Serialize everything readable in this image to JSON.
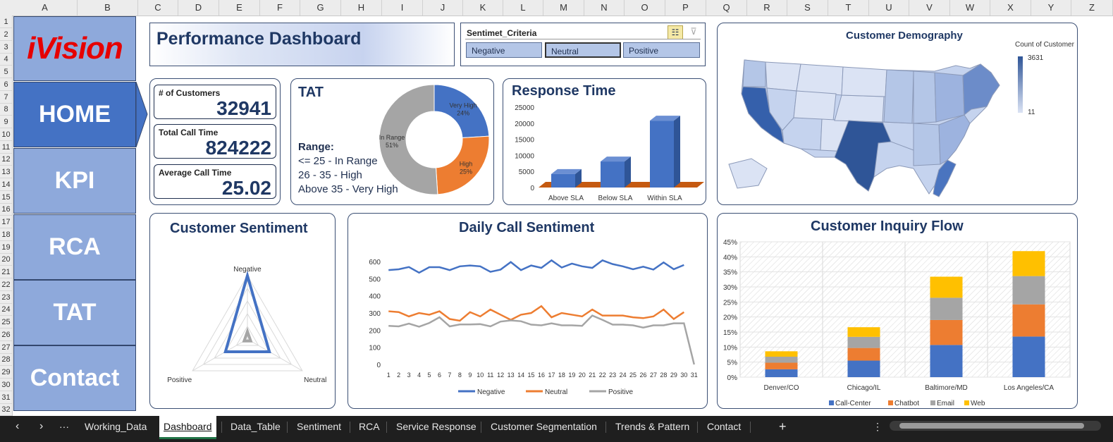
{
  "columns": [
    "A",
    "B",
    "C",
    "D",
    "E",
    "F",
    "G",
    "H",
    "I",
    "J",
    "K",
    "L",
    "M",
    "N",
    "O",
    "P",
    "Q",
    "R",
    "S",
    "T",
    "U",
    "V",
    "W",
    "X",
    "Y",
    "Z"
  ],
  "rows": [
    "1",
    "2",
    "3",
    "4",
    "5",
    "6",
    "7",
    "8",
    "9",
    "10",
    "11",
    "12",
    "13",
    "14",
    "15",
    "16",
    "17",
    "18",
    "19",
    "20",
    "21",
    "22",
    "23",
    "24",
    "25",
    "26",
    "27",
    "28",
    "29",
    "30",
    "31",
    "32"
  ],
  "logo_text": "iVision",
  "nav": {
    "home": "HOME",
    "kpi": "KPI",
    "rca": "RCA",
    "tat": "TAT",
    "contact": "Contact"
  },
  "title": "Performance Dashboard",
  "slicer": {
    "header": "Sentimet_Criteria",
    "options": [
      "Negative",
      "Neutral",
      "Positive"
    ],
    "selected": "Neutral"
  },
  "kpis": {
    "customers": {
      "label": "# of Customers",
      "value": "32941"
    },
    "call_time": {
      "label": "Total Call Time",
      "value": "824222"
    },
    "avg_time": {
      "label": "Average Call Time",
      "value": "25.02"
    }
  },
  "tat": {
    "title": "TAT",
    "range_title": "Range:",
    "range_lines": [
      "<= 25 - In Range",
      "26 - 35 - High",
      "Above 35 - Very High"
    ]
  },
  "response": {
    "title": "Response Time"
  },
  "demography": {
    "title": "Customer Demography",
    "legend_title": "Count of Customer",
    "legend_max": "3631",
    "legend_min": "11"
  },
  "sentiment": {
    "title": "Customer Sentiment"
  },
  "daily": {
    "title": "Daily Call Sentiment"
  },
  "inquiry": {
    "title": "Customer Inquiry Flow"
  },
  "chart_data": [
    {
      "type": "pie",
      "variant": "donut",
      "labels": [
        "Very High",
        "High",
        "In Range"
      ],
      "values": [
        24,
        25,
        51
      ],
      "colors": [
        "#4472c4",
        "#ed7d31",
        "#a5a5a5"
      ]
    },
    {
      "type": "bar",
      "variant": "3d-column",
      "title": "Response Time",
      "categories": [
        "Above SLA",
        "Below SLA",
        "Within SLA"
      ],
      "values": [
        4200,
        8100,
        20800
      ],
      "ylim": [
        0,
        25000
      ],
      "yticks": [
        0,
        5000,
        10000,
        15000,
        20000,
        25000
      ],
      "color": "#4472c4"
    },
    {
      "type": "radar",
      "title": "Customer Sentiment",
      "axes": [
        "Negative",
        "Neutral",
        "Positive"
      ],
      "series": [
        {
          "values": [
            100,
            40,
            40
          ],
          "color": "#4472c4"
        },
        {
          "values": [
            12,
            6,
            6
          ],
          "color": "#a5a5a5"
        }
      ]
    },
    {
      "type": "line",
      "title": "Daily Call Sentiment",
      "x": [
        1,
        2,
        3,
        4,
        5,
        6,
        7,
        8,
        9,
        10,
        11,
        12,
        13,
        14,
        15,
        16,
        17,
        18,
        19,
        20,
        21,
        22,
        23,
        24,
        25,
        26,
        27,
        28,
        29,
        30,
        31
      ],
      "ylim": [
        0,
        600
      ],
      "yticks": [
        0,
        100,
        200,
        300,
        400,
        500,
        600
      ],
      "series": [
        {
          "name": "Negative",
          "color": "#4472c4",
          "values": [
            550,
            555,
            568,
            535,
            567,
            567,
            550,
            572,
            577,
            572,
            540,
            553,
            597,
            550,
            577,
            563,
            607,
            565,
            588,
            572,
            563,
            607,
            585,
            572,
            555,
            570,
            553,
            595,
            555,
            580
          ]
        },
        {
          "name": "Neutral",
          "color": "#ed7d31",
          "values": [
            310,
            305,
            280,
            300,
            290,
            310,
            265,
            255,
            305,
            280,
            320,
            290,
            260,
            290,
            300,
            340,
            275,
            300,
            290,
            280,
            320,
            285,
            285,
            285,
            275,
            270,
            280,
            320,
            265,
            305
          ]
        },
        {
          "name": "Positive",
          "color": "#a5a5a5",
          "values": [
            225,
            222,
            238,
            220,
            242,
            275,
            222,
            233,
            233,
            235,
            222,
            250,
            257,
            252,
            232,
            228,
            240,
            228,
            228,
            225,
            285,
            260,
            232,
            232,
            228,
            215,
            228,
            228,
            240,
            240,
            0
          ]
        }
      ]
    },
    {
      "type": "bar",
      "variant": "stacked-column",
      "title": "Customer Inquiry Flow",
      "categories": [
        "Denver/CO",
        "Chicago/IL",
        "Baltimore/MD",
        "Los Angeles/CA"
      ],
      "ylim": [
        0,
        45
      ],
      "yticks": [
        "0%",
        "5%",
        "10%",
        "15%",
        "20%",
        "25%",
        "30%",
        "35%",
        "40%",
        "45%"
      ],
      "series": [
        {
          "name": "Call-Center",
          "color": "#4472c4",
          "values": [
            2.6,
            5.5,
            10.7,
            13.5
          ]
        },
        {
          "name": "Chatbot",
          "color": "#ed7d31",
          "values": [
            2.2,
            4.2,
            8.3,
            10.7
          ]
        },
        {
          "name": "Email",
          "color": "#a5a5a5",
          "values": [
            2.0,
            3.7,
            7.4,
            9.4
          ]
        },
        {
          "name": "Web",
          "color": "#ffc000",
          "values": [
            1.8,
            3.2,
            7.0,
            8.3
          ]
        }
      ]
    }
  ],
  "tabs": [
    "Working_Data",
    "Dashboard",
    "Data_Table",
    "Sentiment",
    "RCA",
    "Service Response",
    "Customer Segmentation",
    "Trends & Pattern",
    "Contact"
  ],
  "active_tab": "Dashboard",
  "tabbar_glyphs": {
    "prev": "‹",
    "next": "›",
    "more": "···",
    "add": "+",
    "options": "⋮"
  }
}
